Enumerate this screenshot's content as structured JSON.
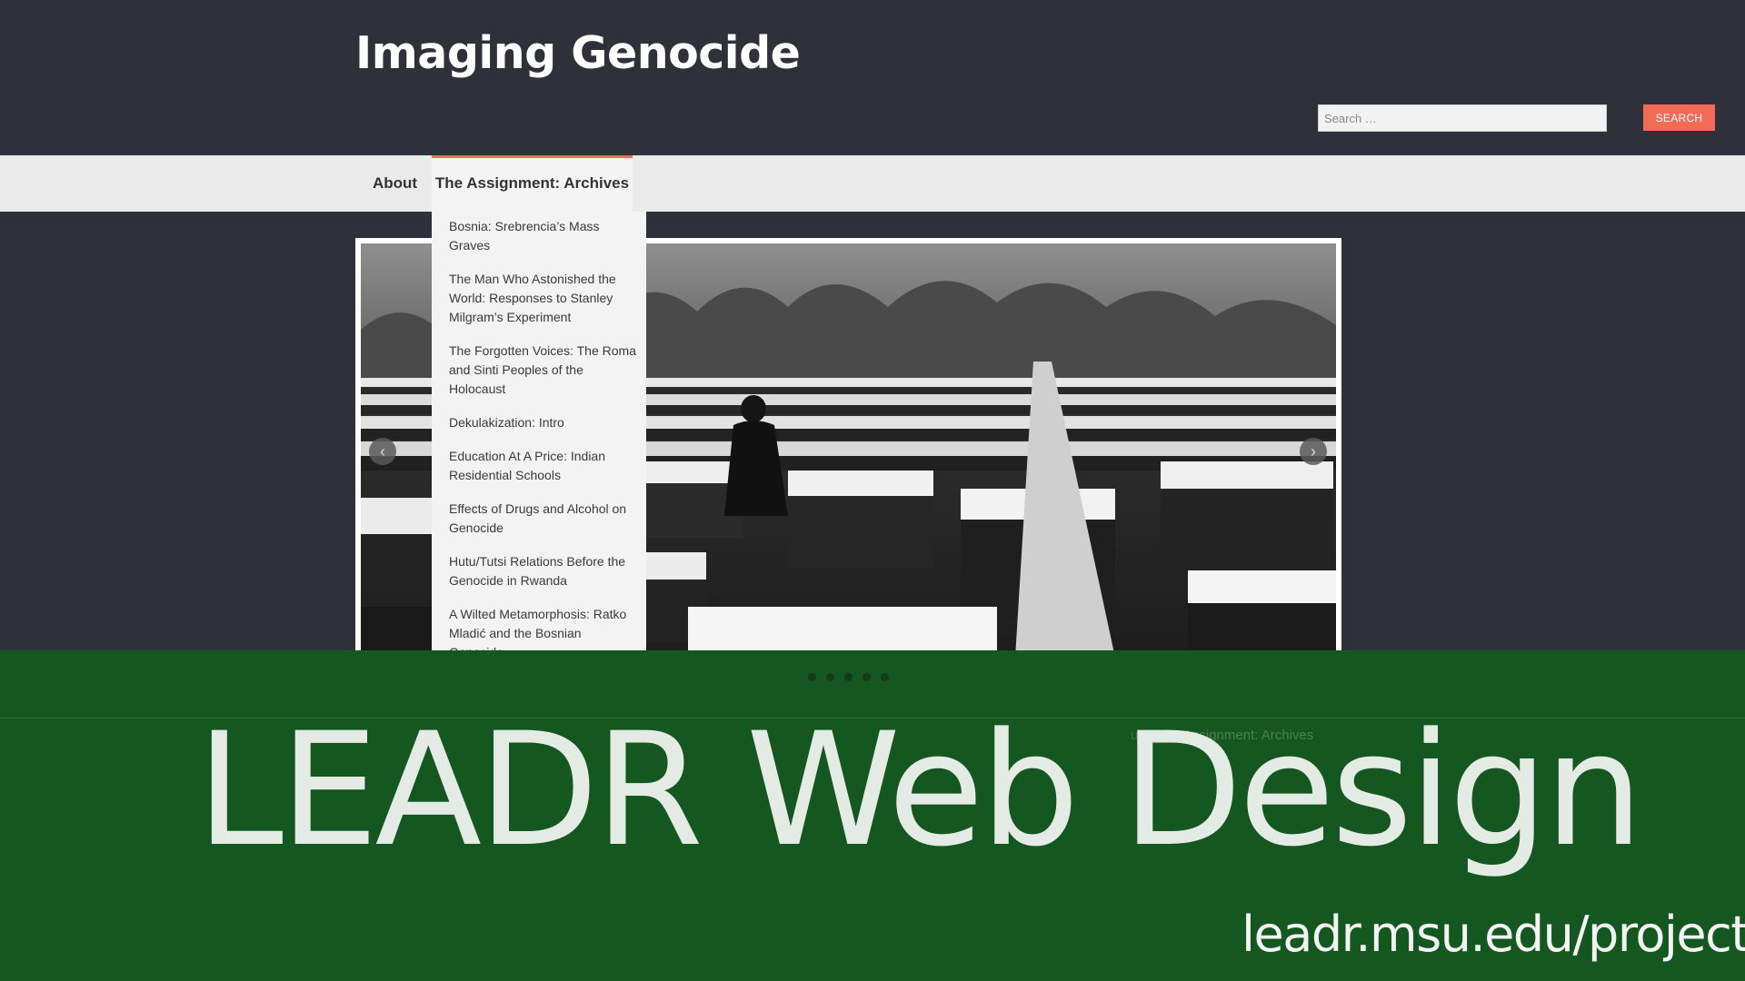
{
  "header": {
    "site_title": "Imaging Genocide",
    "search": {
      "placeholder": "Search …",
      "button_label": "SEARCH"
    }
  },
  "nav": {
    "items": [
      {
        "label": "About"
      },
      {
        "label": "The Assignment: Archives",
        "active": true
      }
    ]
  },
  "dropdown": {
    "items": [
      "Bosnia: Srebrencia’s Mass Graves",
      "The Man Who Astonished the World: Responses to Stanley Milgram’s Experiment",
      "The Forgotten Voices: The Roma and Sinti Peoples of the Holocaust",
      "Dekulakization: Intro",
      "Education At A Price: Indian Residential Schools",
      "Effects of Drugs and Alcohol on Genocide",
      "Hutu/Tutsi Relations Before the Genocide in Rwanda",
      "A Wilted Metamorphosis: Ratko Mladić and the Bosnian Genocide"
    ]
  },
  "slider": {
    "prev_icon": "chevron-left-icon",
    "next_icon": "chevron-right-icon",
    "prev_glyph": "‹",
    "next_glyph": "›",
    "dots": 5,
    "active_dot": 1
  },
  "breadcrumb": {
    "parent": "ut",
    "current": "The Assignment: Archives"
  },
  "overlay": {
    "title": "LEADR Web Design",
    "url": "leadr.msu.edu/projects",
    "band_color": "#145721"
  },
  "colors": {
    "header_bg": "#2f3039",
    "accent": "#f26b55",
    "nav_bg": "#eaeaea"
  }
}
